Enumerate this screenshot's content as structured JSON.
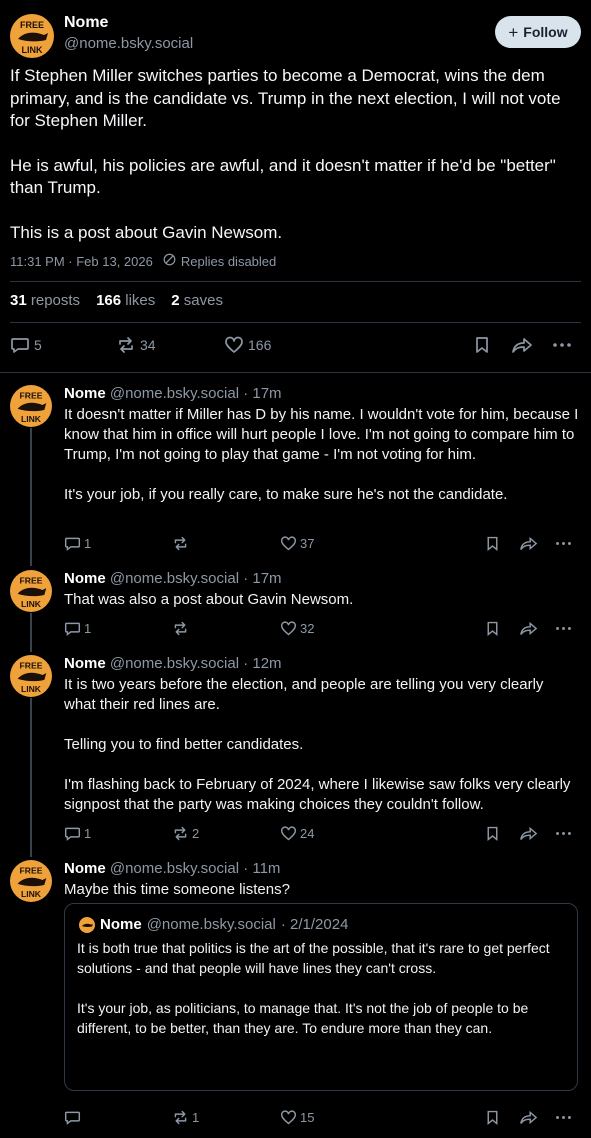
{
  "post": {
    "author_name": "Nome",
    "author_handle": "@nome.bsky.social",
    "follow_label": "Follow",
    "paragraphs": [
      "If Stephen Miller switches parties to become a Democrat, wins the dem primary, and is the candidate vs. Trump in the next election, I will not vote for Stephen Miller.",
      "He is awful, his policies are awful, and it doesn't matter if he'd be \"better\" than Trump.",
      "This is a post about Gavin Newsom."
    ],
    "timestamp": "11:31 PM · Feb 13, 2026",
    "replies_status": "Replies disabled",
    "reposts_count": "31",
    "reposts_label": "reposts",
    "likes_count": "166",
    "likes_label": "likes",
    "saves_count": "2",
    "saves_label": "saves",
    "action_replies": "5",
    "action_reposts": "34",
    "action_likes": "166"
  },
  "replies": [
    {
      "name": "Nome",
      "handle": "@nome.bsky.social",
      "age": "· 17m",
      "paragraphs": [
        "It doesn't matter if Miller has D by his name. I wouldn't vote for him, because I know that him in office will hurt people I love. I'm not going to compare him to Trump, I'm not going to play that game - I'm not voting for him.",
        "It's your job, if you really care, to make sure he's not the candidate."
      ],
      "replies": "1",
      "reposts": "",
      "likes": "37"
    },
    {
      "name": "Nome",
      "handle": "@nome.bsky.social",
      "age": "· 17m",
      "paragraphs": [
        "That was also a post about Gavin Newsom."
      ],
      "replies": "1",
      "reposts": "",
      "likes": "32"
    },
    {
      "name": "Nome",
      "handle": "@nome.bsky.social",
      "age": "· 12m",
      "paragraphs": [
        "It is two years before the election, and people are telling you very clearly what their red lines are.",
        "Telling you to find better candidates.",
        "I'm flashing back to February of 2024, where I likewise saw folks very clearly signpost that the party was making choices they couldn't follow."
      ],
      "replies": "1",
      "reposts": "2",
      "likes": "24"
    },
    {
      "name": "Nome",
      "handle": "@nome.bsky.social",
      "age": "· 11m",
      "paragraphs": [
        "Maybe this time someone listens?"
      ],
      "replies": "",
      "reposts": "1",
      "likes": "15",
      "quote": {
        "name": "Nome",
        "handle": "@nome.bsky.social",
        "date": "· 2/1/2024",
        "paragraphs": [
          "It is both true that politics is the art of the possible, that it's rare to get perfect solutions - and that people will have lines they can't cross.",
          "It's your job, as politicians, to manage that. It's not the job of people to be different, to be better, than they are. To endure more than they can."
        ]
      }
    }
  ],
  "avatar_text_top": "FREE",
  "avatar_text_bottom": "LINK",
  "colors": {
    "background": "#000000",
    "muted": "#8d98a5",
    "avatar": "#f0a23a",
    "follow_bg": "#d9e3ec",
    "divider": "#2a3340"
  },
  "icons": [
    "plus-icon",
    "reply-icon",
    "repost-icon",
    "like-icon",
    "bookmark-icon",
    "share-icon",
    "more-icon",
    "lock-icon"
  ]
}
